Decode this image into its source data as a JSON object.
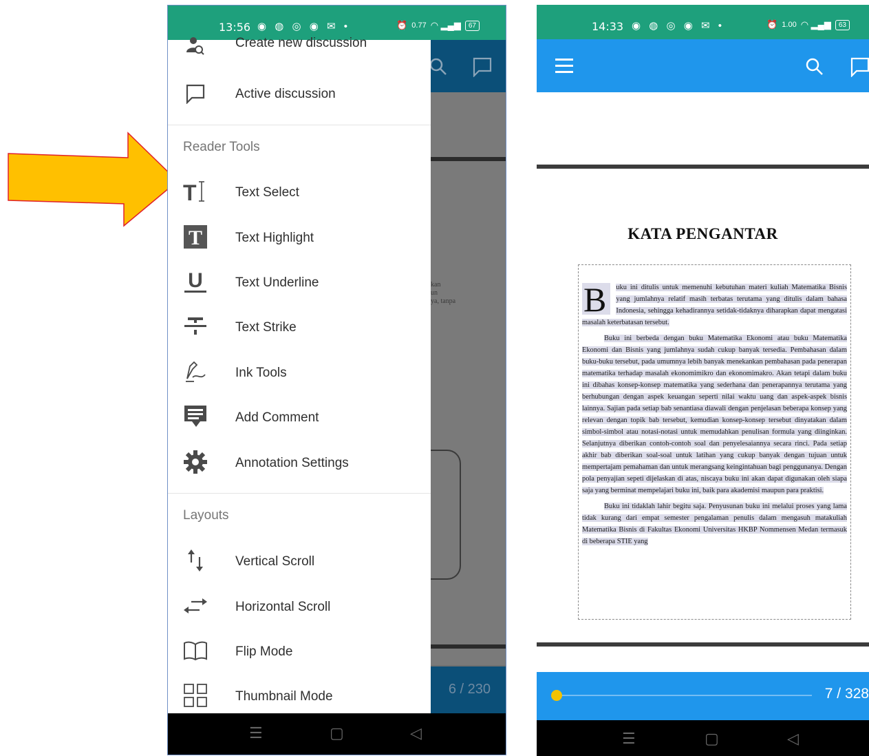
{
  "left_phone": {
    "status": {
      "time": "13:56",
      "speed": "0.77",
      "speed_unit": "KB/S",
      "battery": "67"
    },
    "drawer": {
      "items_top": [
        {
          "label": "Create new discussion",
          "icon": "discussion-user-icon"
        },
        {
          "label": "Active discussion",
          "icon": "chat-bubble-icon"
        }
      ],
      "section_reader_tools": "Reader Tools",
      "reader_tools": [
        {
          "label": "Text Select",
          "icon": "text-select-icon"
        },
        {
          "label": "Text Highlight",
          "icon": "text-highlight-icon"
        },
        {
          "label": "Text Underline",
          "icon": "text-underline-icon"
        },
        {
          "label": "Text Strike",
          "icon": "text-strike-icon"
        },
        {
          "label": "Ink Tools",
          "icon": "pen-icon"
        },
        {
          "label": "Add Comment",
          "icon": "comment-icon"
        },
        {
          "label": "Annotation Settings",
          "icon": "gear-icon"
        }
      ],
      "section_layouts": "Layouts",
      "layouts": [
        {
          "label": "Vertical Scroll",
          "icon": "vertical-arrows-icon"
        },
        {
          "label": "Horizontal Scroll",
          "icon": "horizontal-arrows-icon"
        },
        {
          "label": "Flip Mode",
          "icon": "book-icon"
        },
        {
          "label": "Thumbnail Mode",
          "icon": "grid-icon"
        }
      ]
    },
    "bg_text": [
      "kan",
      "un",
      "ya, tanpa"
    ],
    "page_counter": "6 / 230"
  },
  "right_phone": {
    "status": {
      "time": "14:33",
      "speed": "1.00",
      "speed_unit": "KB/S",
      "battery": "63"
    },
    "document": {
      "title": "KATA PENGANTAR",
      "dropcap": "B",
      "para1": "uku ini ditulis untuk memenuhi kebutuhan materi kuliah Matematika Bisnis yang jumlahnya relatif masih terbatas terutama yang ditulis dalam bahasa Indonesia, sehingga kehadirannya setidak-tidaknya diharapkan dapat mengatasi masalah keterbatasan tersebut.",
      "para2": "Buku ini berbeda dengan buku Matematika Ekonomi atau buku Matematika Ekonomi dan Bisnis yang jumlahnya sudah cukup banyak tersedia. Pembahasan dalam buku-buku tersebut, pada umumnya lebih banyak menekankan pembahasan pada penerapan matematika terhadap masalah ekonomimikro dan ekonomimakro. Akan tetapi dalam buku ini dibahas konsep-konsep matematika yang sederhana dan penerapannya terutama yang berhubungan dengan aspek keuangan seperti nilai waktu uang dan aspek-aspek bisnis lainnya. Sajian pada setiap bab senantiasa diawali dengan penjelasan beberapa konsep yang relevan dengan topik bab tersebut, kemudian konsep-konsep tersebut dinyatakan dalam simbol-simbol atau notasi-notasi untuk memudahkan penulisan formula yang diinginkan. Selanjutnya diberikan contoh-contoh soal dan penyelesaiannya secara rinci. Pada setiap akhir bab diberikan soal-soal untuk latihan yang cukup banyak dengan tujuan untuk mempertajam pemahaman dan untuk merangsang keingintahuan bagi penggunanya. Dengan pola penyajian sepeti dijelaskan di atas, niscaya buku ini akan dapat digunakan oleh siapa saja yang berminat mempelajari buku ini, baik para akademisi maupun para praktisi.",
      "para3": "Buku ini tidaklah lahir begitu saja. Penyusunan buku ini melalui proses yang lama tidak kurang dari empat semester pengalaman penulis dalam mengasuh matakuliah Matematika Bisnis di Fakultas Ekonomi Universitas HKBP Nommensen Medan termasuk di beberapa STIE yang"
    },
    "page_counter": "7 / 328"
  },
  "colors": {
    "status_green": "#1ea07c",
    "app_blue": "#1f96ec",
    "dark_blue": "#0b4f78",
    "arrow_fill": "#ffc000",
    "arrow_stroke": "#e0202a"
  }
}
